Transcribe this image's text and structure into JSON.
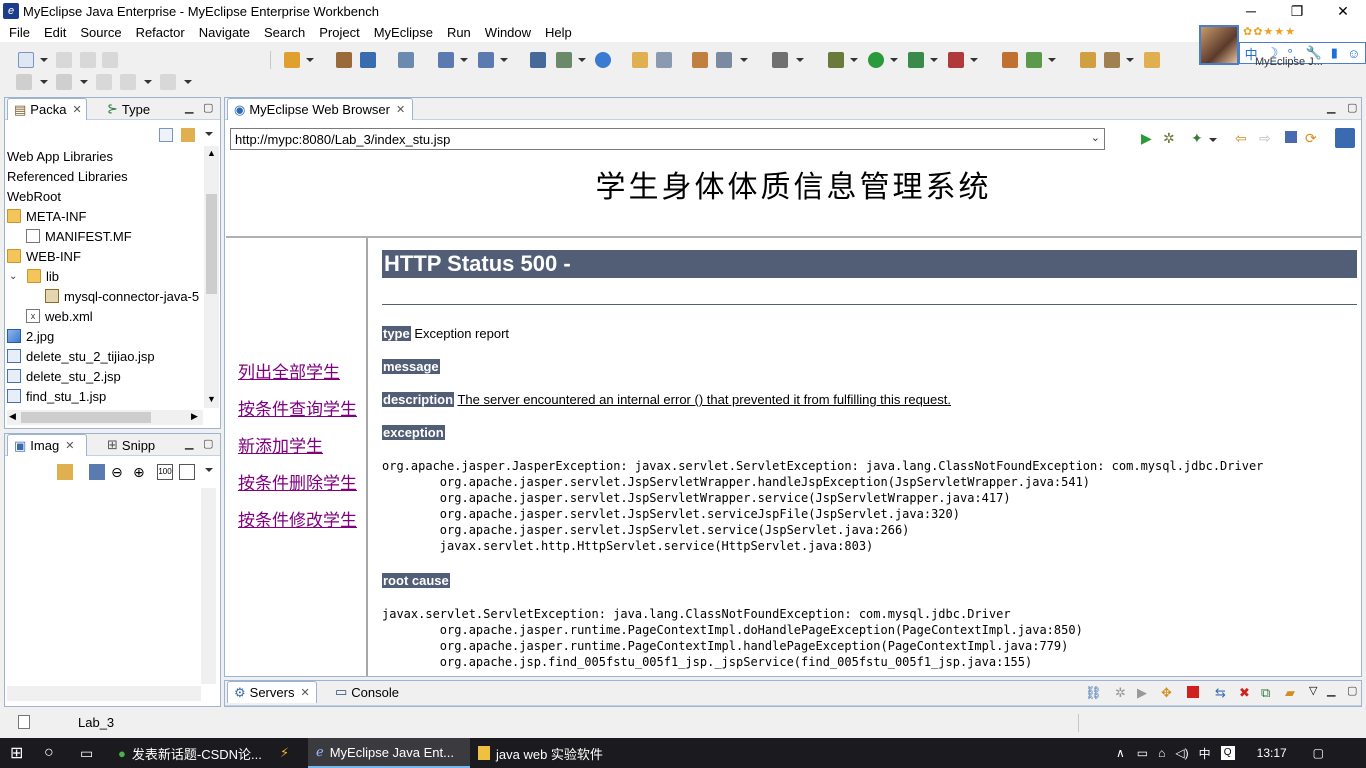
{
  "window": {
    "title": "MyEclipse Java Enterprise - MyEclipse Enterprise Workbench",
    "minimize_glyph": "─",
    "restore_glyph": "❐",
    "close_glyph": "✕"
  },
  "menu": [
    "File",
    "Edit",
    "Source",
    "Refactor",
    "Navigate",
    "Search",
    "Project",
    "MyEclipse",
    "Run",
    "Window",
    "Help"
  ],
  "ime": {
    "stars": "✿✿★★★",
    "mode_chars": [
      "中",
      "☽",
      "°,",
      "🔧",
      "▮",
      "☺"
    ],
    "perspective_text": "MyEclipse J..."
  },
  "package_explorer": {
    "tab_active": "Packa",
    "tab_other": "Type",
    "tree": [
      {
        "label": "Web App Libraries",
        "indent": 0,
        "icon": "none",
        "chev": ""
      },
      {
        "label": "Referenced Libraries",
        "indent": 0,
        "icon": "none",
        "chev": ""
      },
      {
        "label": "WebRoot",
        "indent": 0,
        "icon": "none",
        "chev": ""
      },
      {
        "label": "META-INF",
        "indent": 0,
        "icon": "folder",
        "chev": ""
      },
      {
        "label": "MANIFEST.MF",
        "indent": 1,
        "icon": "file",
        "chev": ""
      },
      {
        "label": "WEB-INF",
        "indent": 0,
        "icon": "folder",
        "chev": ""
      },
      {
        "label": "lib",
        "indent": 0,
        "icon": "folder",
        "chev": "v"
      },
      {
        "label": "mysql-connector-java-5",
        "indent": 2,
        "icon": "jar",
        "chev": ""
      },
      {
        "label": "web.xml",
        "indent": 1,
        "icon": "xml",
        "chev": ""
      },
      {
        "label": "2.jpg",
        "indent": 0,
        "icon": "img",
        "chev": ""
      },
      {
        "label": "delete_stu_2_tijiao.jsp",
        "indent": 0,
        "icon": "jsp",
        "chev": ""
      },
      {
        "label": "delete_stu_2.jsp",
        "indent": 0,
        "icon": "jsp",
        "chev": ""
      },
      {
        "label": "find_stu_1.jsp",
        "indent": 0,
        "icon": "jsp",
        "chev": ""
      }
    ]
  },
  "image_panel": {
    "tab_active": "Imag",
    "tab_other": "Snipp"
  },
  "browser": {
    "tab": "MyEclipse Web Browser",
    "url": "http://mypc:8080/Lab_3/index_stu.jsp",
    "page": {
      "heading": "学生身体体质信息管理系统",
      "nav_links": [
        "列出全部学生",
        "按条件查询学生",
        "新添加学生",
        "按条件删除学生",
        "按条件修改学生"
      ],
      "error": {
        "title": "HTTP Status 500 -",
        "type_label": "type",
        "type_value": "Exception report",
        "message_label": "message",
        "description_label": "description",
        "description_value": "The server encountered an internal error () that prevented it from fulfilling this request.",
        "exception_label": "exception",
        "exception_trace": "org.apache.jasper.JasperException: javax.servlet.ServletException: java.lang.ClassNotFoundException: com.mysql.jdbc.Driver\n\torg.apache.jasper.servlet.JspServletWrapper.handleJspException(JspServletWrapper.java:541)\n\torg.apache.jasper.servlet.JspServletWrapper.service(JspServletWrapper.java:417)\n\torg.apache.jasper.servlet.JspServlet.serviceJspFile(JspServlet.java:320)\n\torg.apache.jasper.servlet.JspServlet.service(JspServlet.java:266)\n\tjavax.servlet.http.HttpServlet.service(HttpServlet.java:803)",
        "root_cause_label": "root cause",
        "root_cause_trace": "javax.servlet.ServletException: java.lang.ClassNotFoundException: com.mysql.jdbc.Driver\n\torg.apache.jasper.runtime.PageContextImpl.doHandlePageException(PageContextImpl.java:850)\n\torg.apache.jasper.runtime.PageContextImpl.handlePageException(PageContextImpl.java:779)\n\torg.apache.jsp.find_005fstu_005f1_jsp._jspService(find_005fstu_005f1_jsp.java:155)"
      }
    }
  },
  "bottom_panel": {
    "tab_active": "Servers",
    "tab_other": "Console"
  },
  "status": {
    "project": "Lab_3"
  },
  "taskbar": {
    "items": [
      "发表新话题-CSDN论...",
      "MyEclipse Java Ent...",
      "java web 实验软件"
    ],
    "ime_char": "中",
    "time": "13:17"
  },
  "colors": {
    "error_header": "#525d76",
    "visited_link": "#800080",
    "panel_border": "#9eb3cf",
    "taskbar": "#1b1b1f"
  }
}
